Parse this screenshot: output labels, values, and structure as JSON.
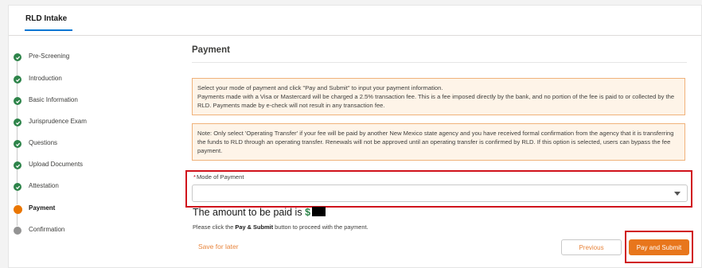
{
  "tab": {
    "label": "RLD Intake"
  },
  "steps": [
    {
      "label": "Pre-Screening",
      "state": "complete"
    },
    {
      "label": "Introduction",
      "state": "complete"
    },
    {
      "label": "Basic Information",
      "state": "complete"
    },
    {
      "label": "Jurisprudence Exam",
      "state": "complete"
    },
    {
      "label": "Questions",
      "state": "complete"
    },
    {
      "label": "Upload Documents",
      "state": "complete"
    },
    {
      "label": "Attestation",
      "state": "complete"
    },
    {
      "label": "Payment",
      "state": "current"
    },
    {
      "label": "Confirmation",
      "state": "pending"
    }
  ],
  "payment": {
    "title": "Payment",
    "notice1": {
      "line1": "Select your mode of payment and click \"Pay and Submit\" to input your payment information.",
      "line2": "Payments made with a Visa or Mastercard will be charged a 2.5% transaction fee. This is a fee imposed directly by the bank, and no portion of the fee is paid to or collected by the RLD. Payments made by e-check will not result in any transaction fee."
    },
    "notice2": "Note: Only select 'Operating Transfer' if your fee will be paid by another New Mexico state agency and you have received formal confirmation from the agency that it is transferring the funds to RLD through an operating transfer. Renewals will not be approved until an operating transfer is confirmed by RLD. If this option is selected, users can bypass the fee payment.",
    "mode_label": "Mode of Payment",
    "mode_required": "*",
    "mode_value": "",
    "amount_text": "The amount to be paid is",
    "amount_symbol": "$",
    "proceed_before": "Please click the",
    "proceed_bold": "Pay & Submit",
    "proceed_after": "button to proceed with the payment."
  },
  "actions": {
    "save_label": "Save for later",
    "previous_label": "Previous",
    "pay_label": "Pay and Submit"
  },
  "colors": {
    "accent": "#e8761c",
    "complete": "#2e844a",
    "highlight": "#d0121b"
  }
}
